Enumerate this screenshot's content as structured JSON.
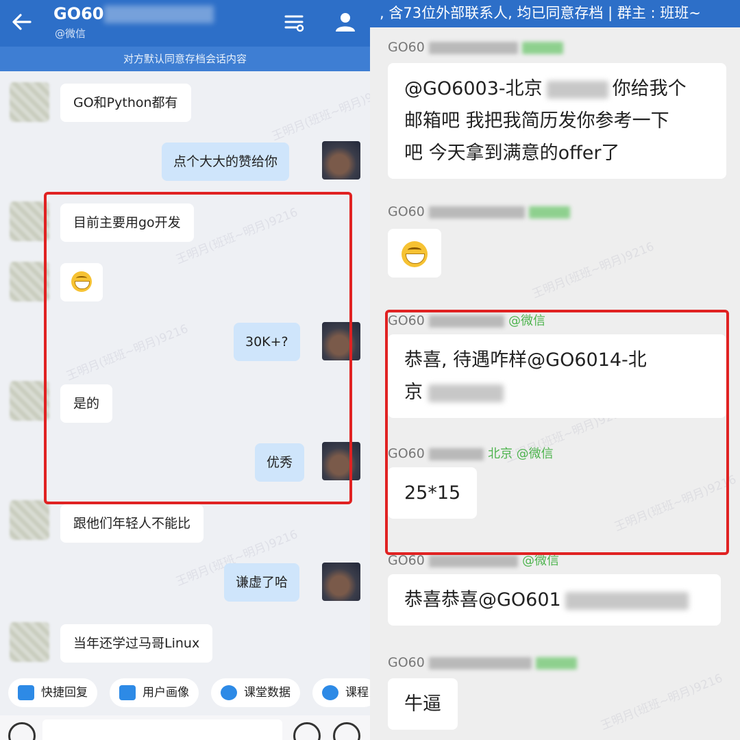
{
  "left": {
    "header": {
      "title": "GO60",
      "subtitle": "@微信",
      "notice": "对方默认同意存档会话内容"
    },
    "messages": [
      {
        "side": "in",
        "text": "GO和Python都有"
      },
      {
        "side": "out",
        "text": "点个大大的赞给你"
      },
      {
        "side": "in",
        "text": "目前主要用go开发"
      },
      {
        "side": "in",
        "text": "",
        "emoji": "grin-emoji"
      },
      {
        "side": "out",
        "text": "30K+?"
      },
      {
        "side": "in",
        "text": "是的"
      },
      {
        "side": "out",
        "text": "优秀"
      },
      {
        "side": "in",
        "text": "跟他们年轻人不能比"
      },
      {
        "side": "out",
        "text": "谦虚了哈"
      },
      {
        "side": "in",
        "text": "当年还学过马哥Linux"
      }
    ],
    "quick_actions": [
      "快捷回复",
      "用户画像",
      "课堂数据",
      "课程"
    ],
    "watermark": "王明月(班班~明月)9216"
  },
  "right": {
    "banner": ", 含73位外部联系人, 均已同意存档 | 群主 : 班班~",
    "messages": [
      {
        "sender": "GO60",
        "sender_tag": "",
        "text_lines": [
          "@GO6003-北京",
          "你给我个",
          "邮箱吧 我把我简历发你参考一下",
          "吧 今天拿到满意的offer了"
        ]
      },
      {
        "sender": "GO60",
        "sender_tag": "北京",
        "text_lines": [],
        "emoji": "grin-emoji"
      },
      {
        "sender": "GO60",
        "sender_tag": "@微信",
        "text_lines": [
          "恭喜, 待遇咋样@GO6014-北",
          "京"
        ]
      },
      {
        "sender": "GO60",
        "sender_tag": "北京 @微信",
        "text_lines": [
          "25*15"
        ]
      },
      {
        "sender": "GO60",
        "sender_tag": "@微信",
        "text_lines": [
          "恭喜恭喜@GO601"
        ]
      },
      {
        "sender": "GO60",
        "sender_tag": "北京",
        "text_lines": [
          "牛逼"
        ]
      }
    ]
  }
}
